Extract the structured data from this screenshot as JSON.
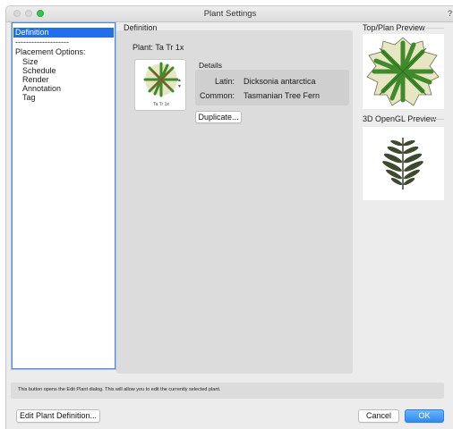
{
  "window": {
    "title": "Plant Settings",
    "help": "?"
  },
  "sidebar": {
    "items": [
      {
        "label": "Definition",
        "selected": true
      },
      {
        "label": "--------------------"
      },
      {
        "label": "Placement Options:"
      },
      {
        "label": "Size"
      },
      {
        "label": "Schedule"
      },
      {
        "label": "Render"
      },
      {
        "label": "Annotation"
      },
      {
        "label": "Tag"
      }
    ]
  },
  "definition": {
    "section_title": "Definition",
    "plant_label": "Plant:  Ta Tr 1x",
    "thumbnail_caption": "Ta Tr 1x",
    "stepper_up": "▲",
    "stepper_down": "▼",
    "details_title": "Details",
    "latin_label": "Latin:",
    "latin_value": "Dicksonia antarctica",
    "common_label": "Common:",
    "common_value": "Tasmanian Tree Fern",
    "duplicate_button": "Duplicate..."
  },
  "previews": {
    "top_plan_title": "Top/Plan Preview",
    "opengl_title": "3D OpenGL Preview"
  },
  "status_text": "This button opens the Edit Plant dialog. This will allow you to edit the currently selected plant.",
  "footer": {
    "edit_button": "Edit Plant Definition...",
    "cancel_button": "Cancel",
    "ok_button": "OK"
  },
  "colors": {
    "accent": "#2b8cf5",
    "selection": "#1f6ff0",
    "fern_green": "#3f8a2a",
    "fern_light": "#e8e5c2"
  },
  "icons": {
    "plant_symbol": "fern-top-view-icon",
    "opengl_preview": "fern-3d-icon"
  }
}
